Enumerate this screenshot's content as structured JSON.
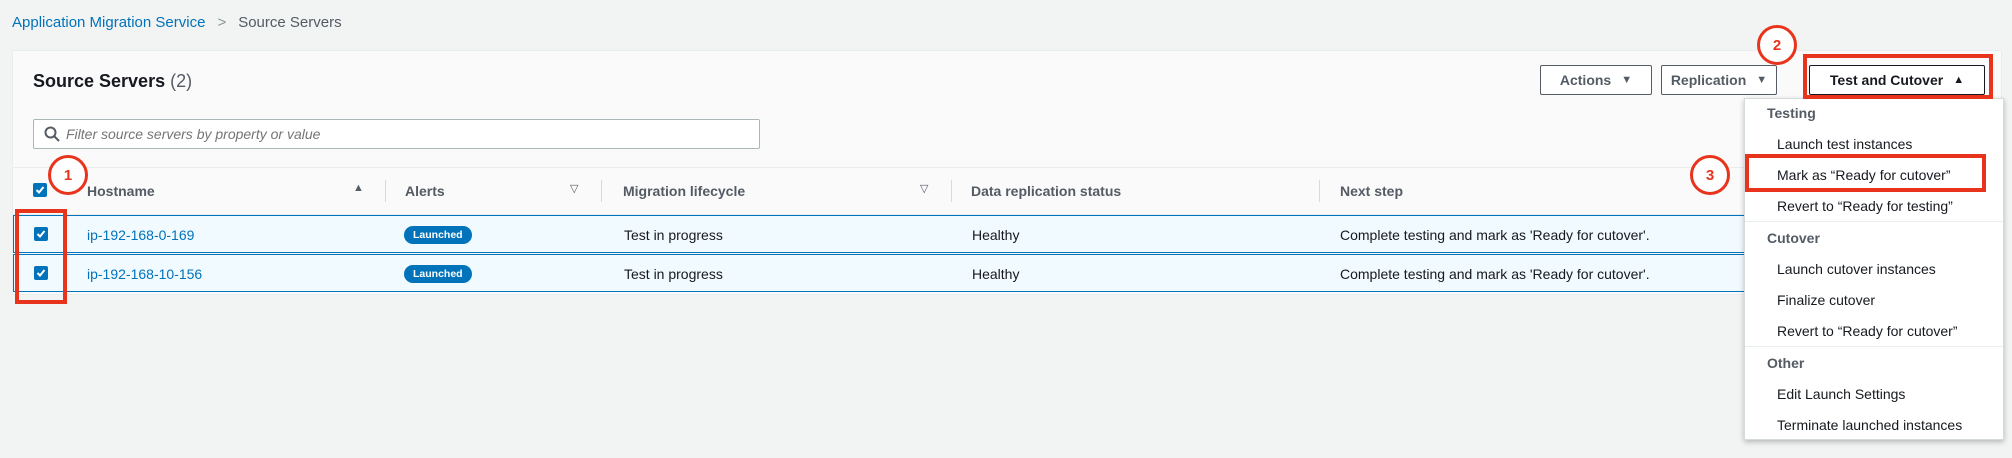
{
  "breadcrumb": {
    "root": "Application Migration Service",
    "current": "Source Servers"
  },
  "panel": {
    "title": "Source Servers",
    "count": "(2)"
  },
  "buttons": {
    "actions": "Actions",
    "replication": "Replication",
    "test_cutover": "Test and Cutover"
  },
  "search": {
    "placeholder": "Filter source servers by property or value"
  },
  "columns": {
    "hostname": "Hostname",
    "alerts": "Alerts",
    "lifecycle": "Migration lifecycle",
    "replication": "Data replication status",
    "next_step": "Next step"
  },
  "rows": [
    {
      "hostname": "ip-192-168-0-169",
      "alert": "Launched",
      "lifecycle": "Test in progress",
      "replication": "Healthy",
      "next_step": "Complete testing and mark as 'Ready for cutover'.",
      "checked": true
    },
    {
      "hostname": "ip-192-168-10-156",
      "alert": "Launched",
      "lifecycle": "Test in progress",
      "replication": "Healthy",
      "next_step": "Complete testing and mark as 'Ready for cutover'.",
      "checked": true
    }
  ],
  "menu": {
    "testing": "Testing",
    "launch_test": "Launch test instances",
    "mark_ready_cutover": "Mark as “Ready for cutover”",
    "revert_ready_testing": "Revert to “Ready for testing”",
    "cutover": "Cutover",
    "launch_cutover": "Launch cutover instances",
    "finalize_cutover": "Finalize cutover",
    "revert_ready_cutover": "Revert to “Ready for cutover”",
    "other": "Other",
    "edit_launch": "Edit Launch Settings",
    "terminate": "Terminate launched instances"
  },
  "callouts": {
    "c1": "1",
    "c2": "2",
    "c3": "3"
  },
  "colors": {
    "accent": "#0073bb",
    "highlight": "#e8341c",
    "badge": "#0073bb"
  },
  "icons": {
    "search": "search-icon",
    "caret_down": "caret-down-icon",
    "caret_up": "caret-up-icon",
    "sort": "sort-icon",
    "check": "checkmark-icon"
  }
}
